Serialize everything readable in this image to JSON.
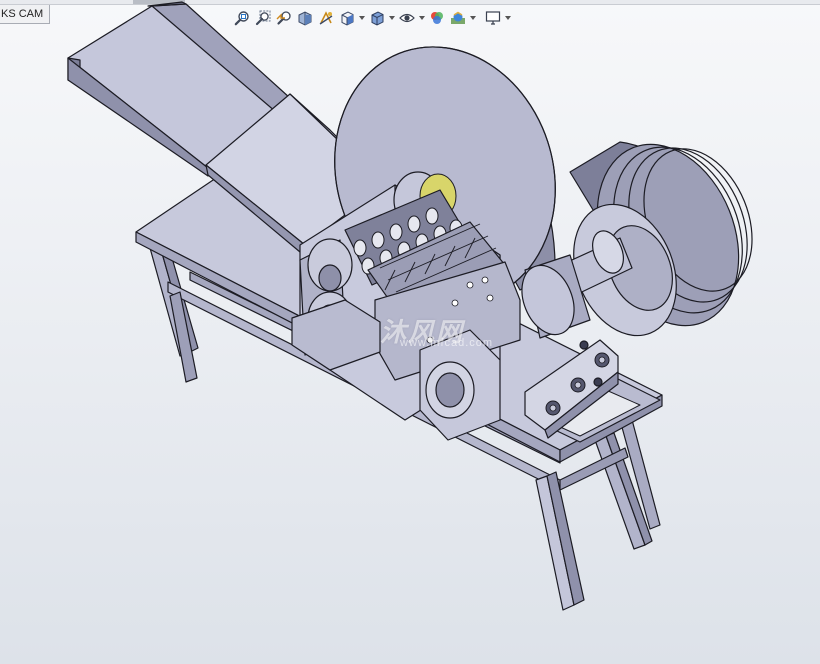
{
  "tab": {
    "label": "KS CAM"
  },
  "hud_icons": [
    "zoom-to-fit-icon",
    "zoom-to-area-icon",
    "previous-view-icon",
    "section-view-icon",
    "dynamic-annotation-icon",
    "view-orientation-icon",
    "display-style-icon",
    "hide-show-items-icon",
    "edit-appearance-icon",
    "apply-scene-icon",
    "view-settings-icon"
  ],
  "watermark": {
    "text": "沐风网",
    "url": "www.mfcad.com"
  },
  "colors": {
    "metal_light": "#c4c6da",
    "metal_mid": "#a9abc3",
    "metal_dark": "#6c6e86",
    "edge": "#1c1c24",
    "accent_yellow": "#d8d56a"
  }
}
